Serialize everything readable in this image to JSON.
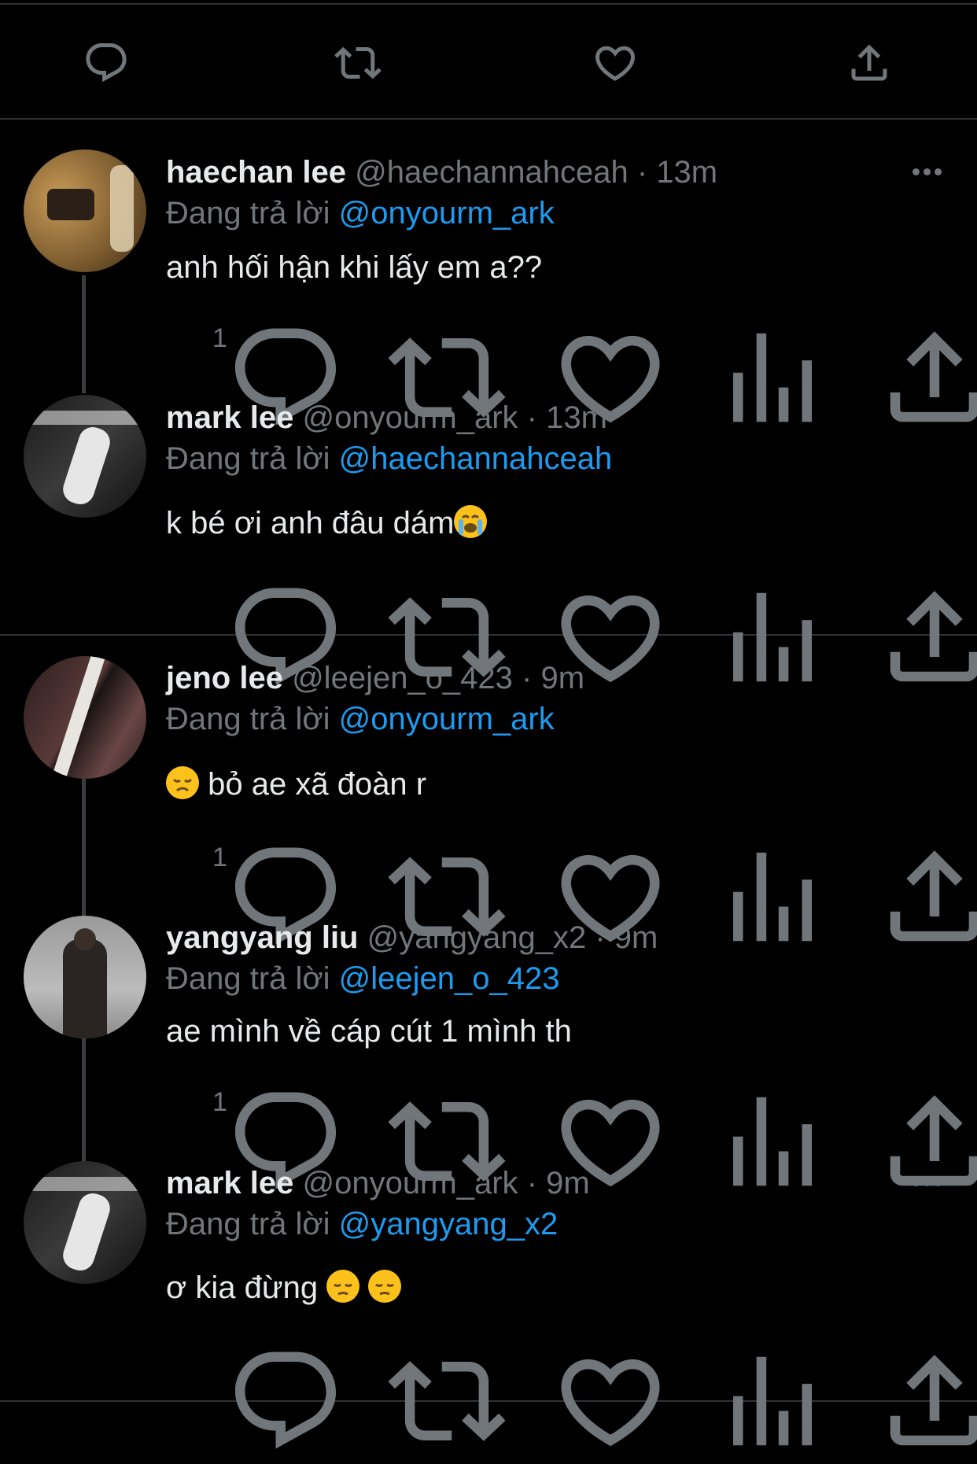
{
  "tweets": [
    {
      "display_name": "haechan lee",
      "handle": "@haechannahceah",
      "time": "· 13m",
      "reply_prefix": "Đang trả lời",
      "reply_to": "@onyourm_ark",
      "text": "anh hối hận khi lấy em a??",
      "reply_count": "1"
    },
    {
      "display_name": "mark lee",
      "handle": "@onyourm_ark",
      "time": "· 13m",
      "reply_prefix": "Đang trả lời",
      "reply_to": "@haechannahceah",
      "text": "k bé ơi anh đâu dám",
      "emoji": "loudly-crying-face",
      "reply_count": ""
    },
    {
      "display_name": "jeno lee",
      "handle": "@leejen_o_423",
      "time": "· 9m",
      "reply_prefix": "Đang trả lời",
      "reply_to": "@onyourm_ark",
      "text": "bỏ ae xã đoàn r",
      "emoji": "disappointed-face",
      "reply_count": "1"
    },
    {
      "display_name": "yangyang liu",
      "handle": "@yangyang_x2",
      "time": "· 9m",
      "reply_prefix": "Đang trả lời",
      "reply_to": "@leejen_o_423",
      "text": "ae mình về cáp cút 1 mình th",
      "reply_count": "1"
    },
    {
      "display_name": "mark lee",
      "handle": "@onyourm_ark",
      "time": "· 9m",
      "reply_prefix": "Đang trả lời",
      "reply_to": "@yangyang_x2",
      "text": "ơ kia đừng",
      "emoji": "pensive-face",
      "reply_count": ""
    }
  ],
  "colors": {
    "background": "#000000",
    "text": "#e7e9ea",
    "muted": "#71767b",
    "mention": "#1d9bf0",
    "divider": "#2f3336"
  },
  "icons": [
    "reply-icon",
    "retweet-icon",
    "like-icon",
    "views-icon",
    "share-icon",
    "more-icon"
  ]
}
